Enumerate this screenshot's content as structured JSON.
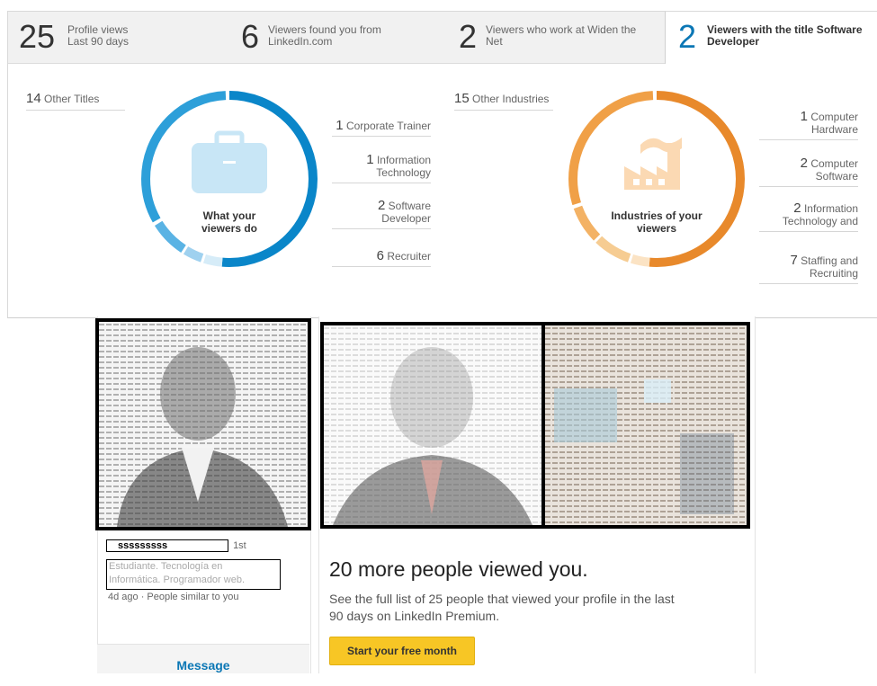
{
  "tabs": [
    {
      "number": "25",
      "line1": "Profile views",
      "line2": "Last 90 days"
    },
    {
      "number": "6",
      "line1": "Viewers found you from",
      "line2": "LinkedIn.com"
    },
    {
      "number": "2",
      "line1": "Viewers who work at Widen the",
      "line2": "Net"
    },
    {
      "number": "2",
      "line1": "Viewers with the title Software",
      "line2": "Developer"
    }
  ],
  "titles_panel": {
    "other_count": "14",
    "other_label": "Other Titles",
    "caption_line1": "What your",
    "caption_line2": "viewers do",
    "icon": "briefcase-icon",
    "accent": "#0a86c9",
    "items": [
      {
        "count": "1",
        "line1": "Corporate Trainer",
        "line2": ""
      },
      {
        "count": "1",
        "line1": "Information",
        "line2": "Technology"
      },
      {
        "count": "2",
        "line1": "Software",
        "line2": "Developer"
      },
      {
        "count": "6",
        "line1": "Recruiter",
        "line2": ""
      }
    ]
  },
  "industries_panel": {
    "other_count": "15",
    "other_label": "Other Industries",
    "caption_line1": "Industries of your",
    "caption_line2": "viewers",
    "icon": "factory-icon",
    "accent": "#e8892b",
    "items": [
      {
        "count": "1",
        "line1": "Computer",
        "line2": "Hardware"
      },
      {
        "count": "2",
        "line1": "Computer",
        "line2": "Software"
      },
      {
        "count": "2",
        "line1": "Information",
        "line2": "Technology and"
      },
      {
        "count": "7",
        "line1": "Staffing and",
        "line2": "Recruiting"
      }
    ]
  },
  "viewer_card": {
    "name": "sssssssss",
    "degree": "1st",
    "headline_line1": "Estudiante. Tecnología en",
    "headline_line2": "Informática. Programador web.",
    "meta": "4d ago · People similar to you",
    "message_label": "Message"
  },
  "premium": {
    "heading": "20 more people viewed you.",
    "body_line1": "See the full list of 25 people that viewed your profile in the last",
    "body_line2": "90 days on LinkedIn Premium.",
    "cta_label": "Start your free month"
  },
  "colors": {
    "linkedin_blue": "#0b77b5",
    "cta_yellow": "#f7c625",
    "ring_blue": "#0a86c9",
    "ring_orange": "#e8892b"
  }
}
